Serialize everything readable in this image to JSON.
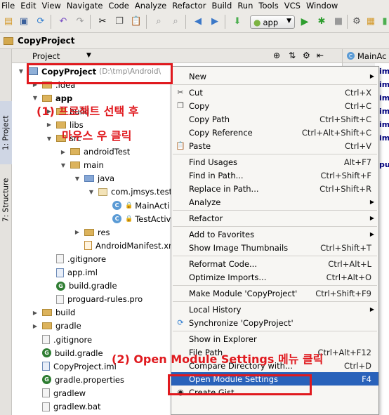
{
  "menubar": [
    "File",
    "Edit",
    "View",
    "Navigate",
    "Code",
    "Analyze",
    "Refactor",
    "Build",
    "Run",
    "Tools",
    "VCS",
    "Window"
  ],
  "toolbar": {
    "run_config": "app"
  },
  "breadcrumb": {
    "project": "CopyProject"
  },
  "side_tabs": {
    "project": "1: Project",
    "structure": "7: Structure"
  },
  "panel": {
    "view_selector": "Project"
  },
  "editor": {
    "tab": "MainAc",
    "code_fragments": [
      "im",
      "im",
      "im",
      "im",
      "im",
      "im",
      "pu"
    ]
  },
  "tree": {
    "root_name": "CopyProject",
    "root_path": "(D:\\tmp\\Android\\",
    "items": [
      {
        "label": ".idea",
        "kind": "folder",
        "depth": 1
      },
      {
        "label": "app",
        "kind": "folder",
        "depth": 1,
        "bold": true
      },
      {
        "label": "build",
        "kind": "folder",
        "depth": 2
      },
      {
        "label": "libs",
        "kind": "folder",
        "depth": 2
      },
      {
        "label": "src",
        "kind": "folder",
        "depth": 2
      },
      {
        "label": "androidTest",
        "kind": "folder",
        "depth": 3
      },
      {
        "label": "main",
        "kind": "folder",
        "depth": 3
      },
      {
        "label": "java",
        "kind": "src",
        "depth": 4
      },
      {
        "label": "com.jmsys.test",
        "kind": "pkg",
        "depth": 5
      },
      {
        "label": "MainActi",
        "kind": "class",
        "depth": 6
      },
      {
        "label": "TestActiv",
        "kind": "class",
        "depth": 6
      },
      {
        "label": "res",
        "kind": "res",
        "depth": 4
      },
      {
        "label": "AndroidManifest.xm",
        "kind": "xml",
        "depth": 4
      },
      {
        "label": ".gitignore",
        "kind": "file",
        "depth": 2
      },
      {
        "label": "app.iml",
        "kind": "iml",
        "depth": 2
      },
      {
        "label": "build.gradle",
        "kind": "gradle",
        "depth": 2
      },
      {
        "label": "proguard-rules.pro",
        "kind": "file",
        "depth": 2
      },
      {
        "label": "build",
        "kind": "folder",
        "depth": 1
      },
      {
        "label": "gradle",
        "kind": "folder",
        "depth": 1
      },
      {
        "label": ".gitignore",
        "kind": "file",
        "depth": 1
      },
      {
        "label": "build.gradle",
        "kind": "gradle",
        "depth": 1
      },
      {
        "label": "CopyProject.iml",
        "kind": "iml",
        "depth": 1
      },
      {
        "label": "gradle.properties",
        "kind": "gradle",
        "depth": 1
      },
      {
        "label": "gradlew",
        "kind": "file",
        "depth": 1
      },
      {
        "label": "gradlew.bat",
        "kind": "file",
        "depth": 1
      }
    ]
  },
  "context_menu": {
    "items": [
      {
        "label": "New",
        "shortcut": "",
        "submenu": true
      },
      {
        "sep": true
      },
      {
        "label": "Cut",
        "shortcut": "Ctrl+X",
        "icon": "scissors-icon"
      },
      {
        "label": "Copy",
        "shortcut": "Ctrl+C",
        "icon": "copy-icon"
      },
      {
        "label": "Copy Path",
        "shortcut": "Ctrl+Shift+C"
      },
      {
        "label": "Copy Reference",
        "shortcut": "Ctrl+Alt+Shift+C"
      },
      {
        "label": "Paste",
        "shortcut": "Ctrl+V",
        "icon": "paste-icon"
      },
      {
        "sep": true
      },
      {
        "label": "Find Usages",
        "shortcut": "Alt+F7"
      },
      {
        "label": "Find in Path...",
        "shortcut": "Ctrl+Shift+F"
      },
      {
        "label": "Replace in Path...",
        "shortcut": "Ctrl+Shift+R"
      },
      {
        "label": "Analyze",
        "shortcut": "",
        "submenu": true
      },
      {
        "sep": true
      },
      {
        "label": "Refactor",
        "shortcut": "",
        "submenu": true
      },
      {
        "sep": true
      },
      {
        "label": "Add to Favorites",
        "shortcut": "",
        "submenu": true
      },
      {
        "label": "Show Image Thumbnails",
        "shortcut": "Ctrl+Shift+T"
      },
      {
        "sep": true
      },
      {
        "label": "Reformat Code...",
        "shortcut": "Ctrl+Alt+L"
      },
      {
        "label": "Optimize Imports...",
        "shortcut": "Ctrl+Alt+O"
      },
      {
        "sep": true
      },
      {
        "label": "Make Module 'CopyProject'",
        "shortcut": "Ctrl+Shift+F9"
      },
      {
        "sep": true
      },
      {
        "label": "Local History",
        "shortcut": "",
        "submenu": true
      },
      {
        "label": "Synchronize 'CopyProject'",
        "shortcut": "",
        "icon": "sync-icon"
      },
      {
        "sep": true
      },
      {
        "label": "Show in Explorer",
        "shortcut": ""
      },
      {
        "label": "File Path",
        "shortcut": "Ctrl+Alt+F12"
      },
      {
        "label": "Compare Directory with...",
        "shortcut": "Ctrl+D"
      },
      {
        "label": "Open Module Settings",
        "shortcut": "F4",
        "highlight": true
      },
      {
        "label": "Create Gist...",
        "shortcut": "",
        "icon": "github-icon"
      }
    ]
  },
  "annotations": {
    "step1_line1": "(1) 프로젝트 선택 후",
    "step1_line2": "마우스 우 클릭",
    "step2": "(2) Open Module Settings 메뉴 클릭"
  },
  "colors": {
    "annotation_red": "#e0191e",
    "highlight_blue": "#2962ba"
  }
}
